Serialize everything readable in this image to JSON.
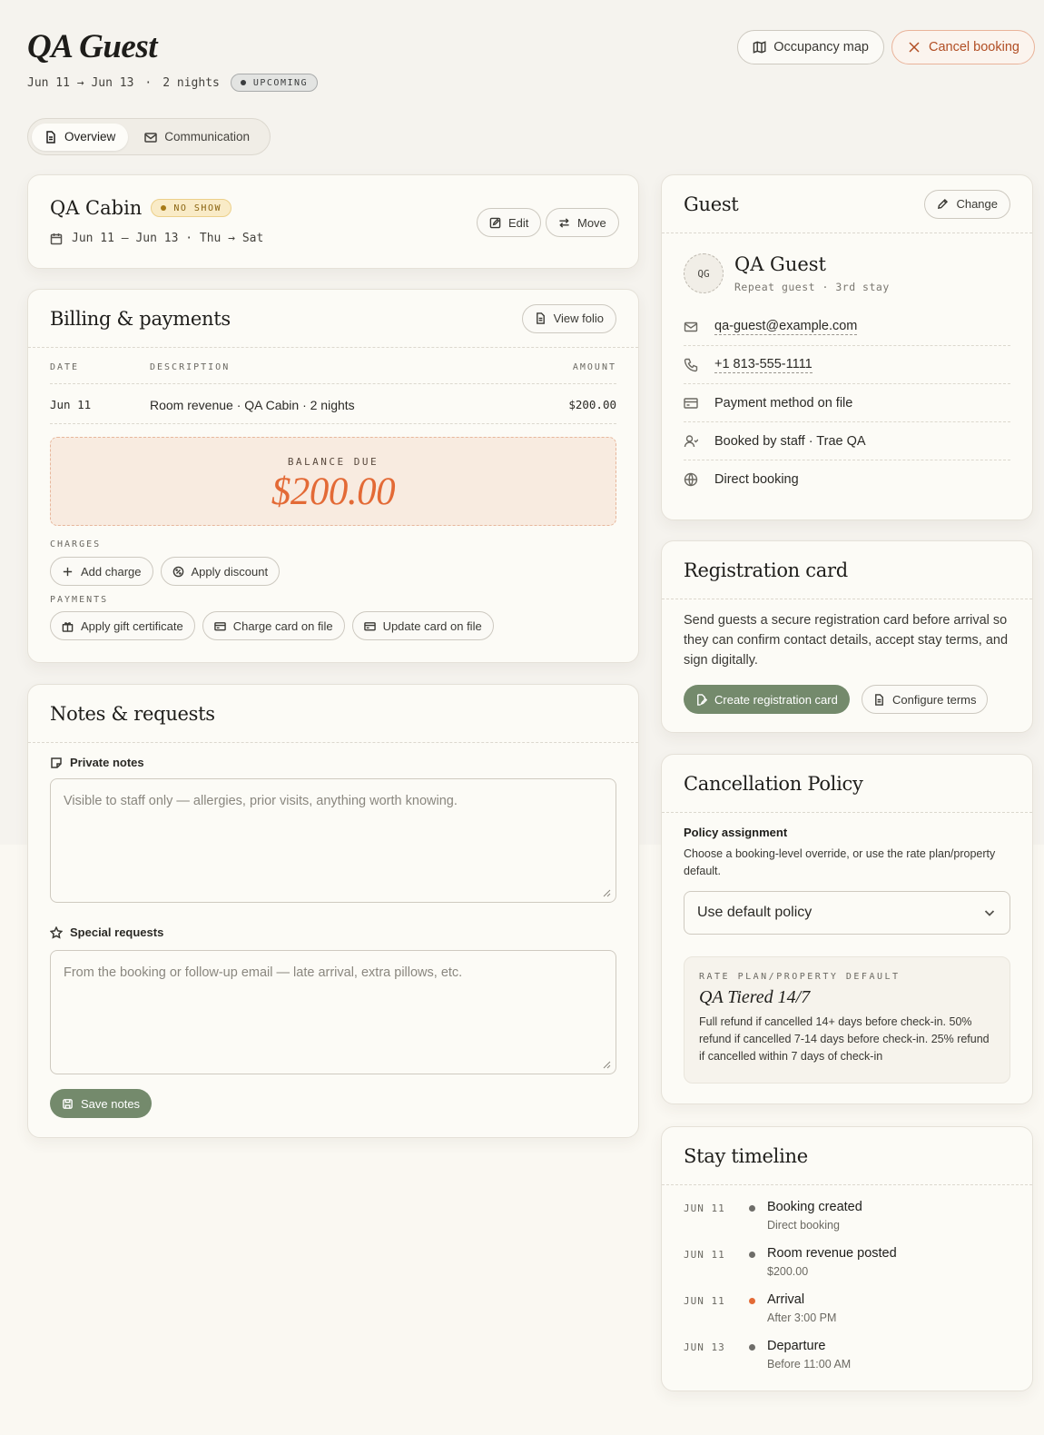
{
  "header": {
    "title": "QA Guest",
    "dates": "Jun 11 → Jun 13",
    "sep": "·",
    "nights": "2 nights",
    "status": "UPCOMING",
    "occupancy_label": "Occupancy map",
    "cancel_label": "Cancel booking"
  },
  "tabs": {
    "overview": "Overview",
    "communication": "Communication"
  },
  "cabin": {
    "name": "QA Cabin",
    "status": "NO SHOW",
    "dates": "Jun 11 — Jun 13 · Thu → Sat",
    "edit_label": "Edit",
    "move_label": "Move"
  },
  "billing": {
    "title": "Billing & payments",
    "view_folio_label": "View folio",
    "columns": {
      "date": "DATE",
      "description": "DESCRIPTION",
      "amount": "AMOUNT"
    },
    "rows": [
      {
        "date": "Jun 11",
        "description": "Room revenue · QA Cabin · 2 nights",
        "amount": "$200.00"
      }
    ],
    "balance_label": "BALANCE DUE",
    "balance_amount": "$200.00",
    "charges_label": "CHARGES",
    "add_charge_label": "Add charge",
    "apply_discount_label": "Apply discount",
    "payments_label": "PAYMENTS",
    "gift_label": "Apply gift certificate",
    "charge_card_label": "Charge card on file",
    "update_card_label": "Update card on file"
  },
  "notes": {
    "title": "Notes & requests",
    "private_label": "Private notes",
    "private_placeholder": "Visible to staff only — allergies, prior visits, anything worth knowing.",
    "special_label": "Special requests",
    "special_placeholder": "From the booking or follow-up email — late arrival, extra pillows, etc.",
    "save_label": "Save notes"
  },
  "guest": {
    "title": "Guest",
    "change_label": "Change",
    "initials": "QG",
    "name": "QA Guest",
    "subtitle": "Repeat guest · 3rd stay",
    "email": "qa-guest@example.com",
    "phone": "+1 813-555-1111",
    "payment": "Payment method on file",
    "booked_by": "Booked by staff · Trae QA",
    "source": "Direct booking"
  },
  "registration": {
    "title": "Registration card",
    "text": "Send guests a secure registration card before arrival so they can confirm contact details, accept stay terms, and sign digitally.",
    "create_label": "Create registration card",
    "configure_label": "Configure terms"
  },
  "cancellation": {
    "title": "Cancellation Policy",
    "assignment_label": "Policy assignment",
    "assignment_help": "Choose a booking-level override, or use the rate plan/property default.",
    "selected": "Use default policy",
    "default_label": "RATE PLAN/PROPERTY DEFAULT",
    "policy_name": "QA Tiered 14/7",
    "policy_desc": "Full refund if cancelled 14+ days before check-in. 50% refund if cancelled 7-14 days before check-in. 25% refund if cancelled within 7 days of check-in"
  },
  "timeline": {
    "title": "Stay timeline",
    "items": [
      {
        "date": "JUN 11",
        "title": "Booking created",
        "sub": "Direct booking",
        "color": "#6e6d69"
      },
      {
        "date": "JUN 11",
        "title": "Room revenue posted",
        "sub": "$200.00",
        "color": "#6e6d69"
      },
      {
        "date": "JUN 11",
        "title": "Arrival",
        "sub": "After 3:00 PM",
        "color": "#e36a36"
      },
      {
        "date": "JUN 13",
        "title": "Departure",
        "sub": "Before 11:00 AM",
        "color": "#6e6d69"
      }
    ]
  },
  "colors": {
    "accent_green": "#748a6c",
    "accent_orange": "#e36a36",
    "cancel_text": "#b14e24"
  },
  "icons": [
    "map-icon",
    "close-icon",
    "document-icon",
    "mail-icon",
    "calendar-icon",
    "edit-icon",
    "move-icon",
    "folio-icon",
    "plus-icon",
    "discount-icon",
    "gift-icon",
    "card-icon",
    "note-icon",
    "star-icon",
    "save-icon",
    "pencil-icon",
    "phone-icon",
    "user-icon",
    "globe-icon",
    "chevron-down-icon",
    "signature-icon"
  ]
}
